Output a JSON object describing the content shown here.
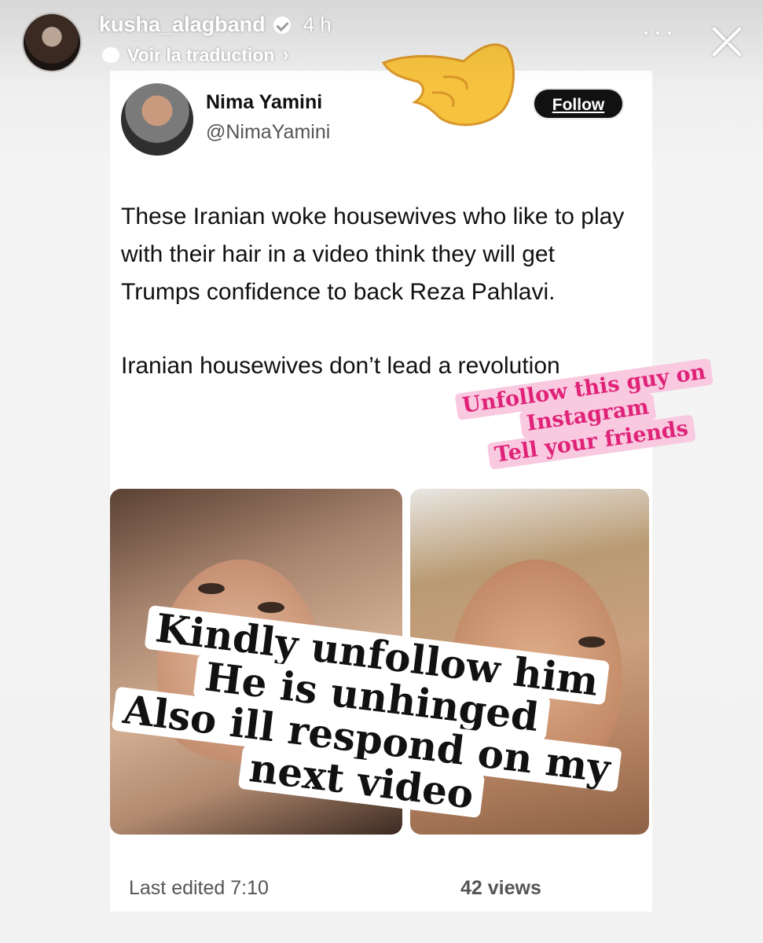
{
  "story_header": {
    "username": "kusha_alagband",
    "timestamp": "4 h",
    "translate_label": "Voir la traduction",
    "more_label": "···"
  },
  "tweet": {
    "author_name": "Nima Yamini",
    "author_handle": "@NimaYamini",
    "follow_label": "Follow",
    "paragraphs": [
      "These Iranian woke housewives  who like to play with their hair in a video think they will get Trumps confidence to back Reza Pahlavi.",
      "Iranian housewives don’t lead a revolution"
    ],
    "footer_edited": "Last edited 7:10",
    "footer_views": "42 views"
  },
  "stickers": {
    "pink_lines": [
      "Unfollow this guy on",
      "Instagram",
      "Tell your friends"
    ],
    "big_lines": [
      "Kindly unfollow him",
      "He is unhinged",
      "Also ill respond on my",
      "next video"
    ]
  },
  "colors": {
    "sticker_pink_bg": "#f8c9df",
    "sticker_pink_text": "#e02279",
    "follow_bg": "#111111"
  }
}
